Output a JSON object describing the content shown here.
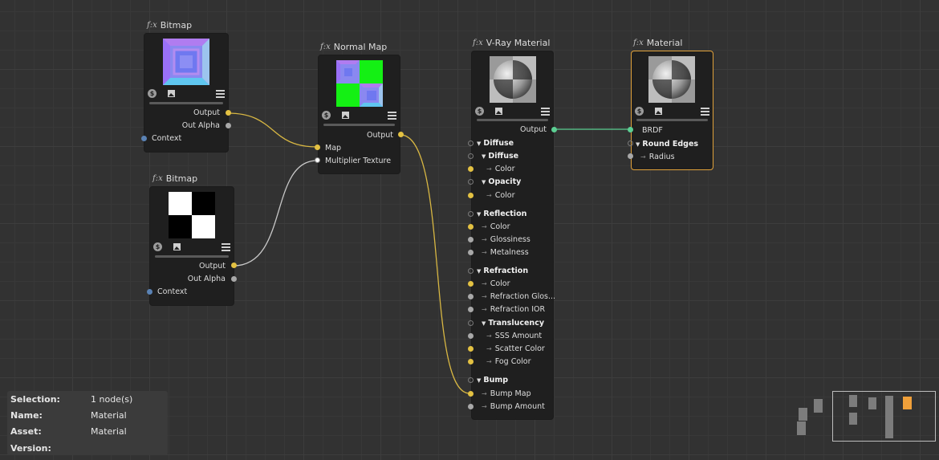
{
  "nodes": {
    "bitmap1": {
      "title": "Bitmap",
      "outputs": [
        "Output",
        "Out Alpha"
      ],
      "inputs": [
        "Context"
      ]
    },
    "bitmap2": {
      "title": "Bitmap",
      "outputs": [
        "Output",
        "Out Alpha"
      ],
      "inputs": [
        "Context"
      ]
    },
    "normal_map": {
      "title": "Normal Map",
      "output": "Output",
      "inputs": [
        "Map",
        "Multiplier Texture"
      ]
    },
    "vray_material": {
      "title": "V-Ray Material",
      "output": "Output",
      "rows": [
        "Diffuse",
        "Diffuse",
        "Color",
        "Opacity",
        "Color",
        "Reflection",
        "Color",
        "Glossiness",
        "Metalness",
        "Refraction",
        "Color",
        "Refraction Glos...",
        "Refraction IOR",
        "Translucency",
        "SSS Amount",
        "Scatter Color",
        "Fog Color",
        "Bump",
        "Bump Map",
        "Bump Amount"
      ]
    },
    "material": {
      "title": "Material",
      "rows": [
        "BRDF",
        "Round Edges",
        "Radius"
      ]
    }
  },
  "info_panel": {
    "selection_label": "Selection:",
    "selection_value": "1 node(s)",
    "name_label": "Name:",
    "name_value": "Material",
    "asset_label": "Asset:",
    "asset_value": "Material",
    "version_label": "Version:",
    "version_value": ""
  },
  "icons": {
    "function": "fx-icon",
    "coin": "coin-icon",
    "image": "image-icon",
    "menu": "menu-icon",
    "expand": "triangle-down-icon"
  },
  "colors": {
    "canvas": "#323232",
    "node": "#1f1f1f",
    "wire_yellow": "#d8b743",
    "wire_white": "#c8c8c8",
    "wire_teal": "#5ccf93",
    "selected_border": "#e0a13a",
    "minimap_highlight": "#f0a03a"
  }
}
